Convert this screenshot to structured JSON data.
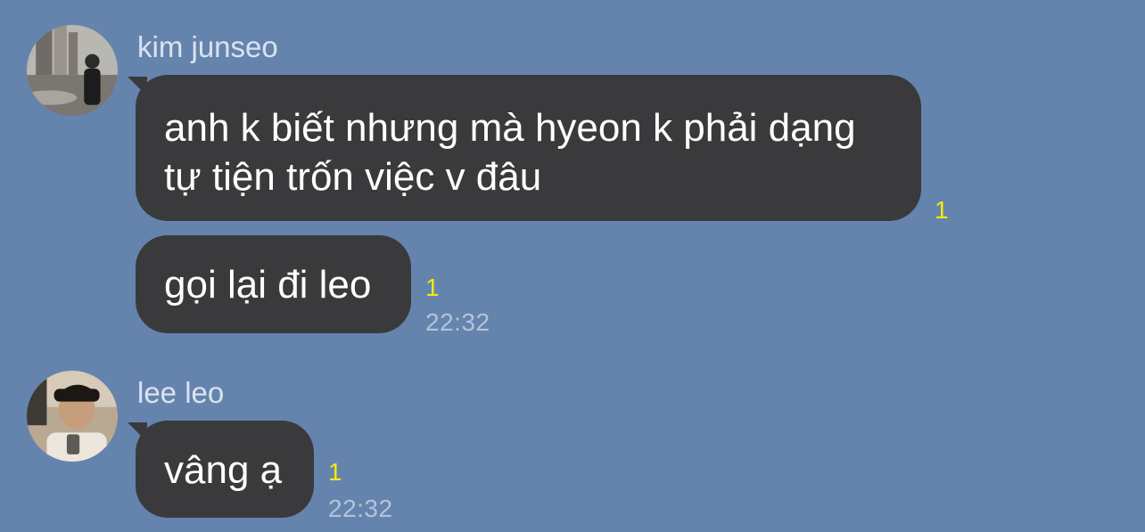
{
  "colors": {
    "background": "#6584ad",
    "bubble": "#3a3a3d",
    "bubble_text": "#ffffff",
    "sender_name": "#d9e3f0",
    "unread_count": "#f5e90c",
    "timestamp": "#b3c3da"
  },
  "groups": [
    {
      "sender": "kim junseo",
      "avatar_icon": "profile-photo",
      "messages": [
        {
          "text": "anh k biết nhưng mà hyeon k phải dạng\ntự tiện trốn việc v đâu",
          "unread": "1",
          "time": ""
        },
        {
          "text": "gọi lại đi leo",
          "unread": "1",
          "time": "22:32"
        }
      ]
    },
    {
      "sender": "lee leo",
      "avatar_icon": "profile-photo",
      "messages": [
        {
          "text": "vâng ạ",
          "unread": "1",
          "time": "22:32"
        }
      ]
    }
  ]
}
